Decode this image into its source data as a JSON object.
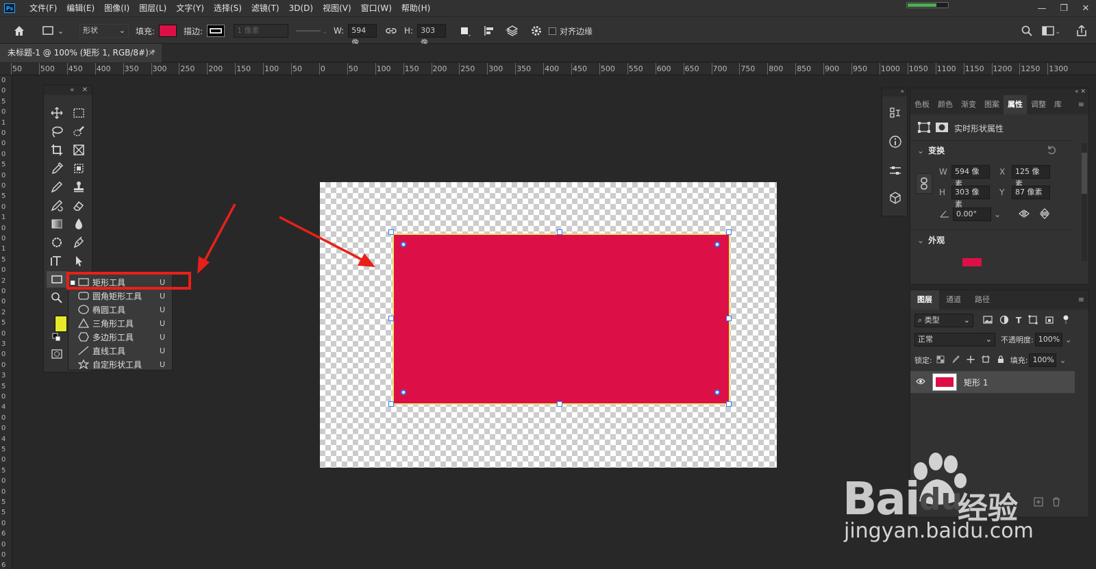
{
  "app": {
    "logo": "Ps"
  },
  "menubar": {
    "items": [
      "文件(F)",
      "编辑(E)",
      "图像(I)",
      "图层(L)",
      "文字(Y)",
      "选择(S)",
      "滤镜(T)",
      "3D(D)",
      "视图(V)",
      "窗口(W)",
      "帮助(H)"
    ],
    "window_buttons": [
      "—",
      "❐",
      "✕"
    ]
  },
  "options": {
    "mode": "形状",
    "fill_label": "填充:",
    "stroke_label": "描边:",
    "stroke_width": "1 像素",
    "w_label": "W:",
    "w_value": "594 像",
    "h_label": "H:",
    "h_value": "303 像",
    "align_edges": "对齐边缘",
    "fill_color": "#dc1046"
  },
  "document": {
    "tab_title": "未标题-1 @ 100% (矩形 1, RGB/8#) *",
    "close": "×"
  },
  "ruler": {
    "h_ticks": [
      "50",
      "500",
      "450",
      "400",
      "350",
      "300",
      "250",
      "200",
      "150",
      "100",
      "50",
      "0",
      "50",
      "100",
      "150",
      "200",
      "250",
      "300",
      "350",
      "400",
      "450",
      "500",
      "550",
      "600",
      "650",
      "700",
      "750",
      "800",
      "850",
      "900",
      "950",
      "1000",
      "1050",
      "1100",
      "1150",
      "1200",
      "1250",
      "1300"
    ],
    "v_ticks": [
      "0",
      "0",
      "5",
      "0",
      "1",
      "0",
      "0",
      "0",
      "5",
      "0",
      "0",
      "5",
      "0",
      "1",
      "0",
      "0",
      "1",
      "5",
      "0",
      "2",
      "0",
      "0",
      "2",
      "5",
      "0",
      "3",
      "0",
      "0",
      "3",
      "5",
      "0",
      "4",
      "0",
      "0",
      "4",
      "5",
      "0",
      "5",
      "0",
      "0",
      "5",
      "5",
      "0",
      "6",
      "0",
      "0",
      "6"
    ]
  },
  "toolbar": {
    "collapse": "«",
    "close": "✕",
    "foreground_color": "#e8e82a"
  },
  "flyout": {
    "items": [
      {
        "label": "矩形工具",
        "key": "U",
        "active": true
      },
      {
        "label": "圆角矩形工具",
        "key": "U"
      },
      {
        "label": "椭圆工具",
        "key": "U"
      },
      {
        "label": "三角形工具",
        "key": "U"
      },
      {
        "label": "多边形工具",
        "key": "U"
      },
      {
        "label": "直线工具",
        "key": "U"
      },
      {
        "label": "自定形状工具",
        "key": "U"
      }
    ]
  },
  "properties_panel": {
    "tabs": [
      "色板",
      "颜色",
      "渐变",
      "图案",
      "属性",
      "调整",
      "库"
    ],
    "active_tab": "属性",
    "shape_props": "实时形状属性",
    "transform_title": "变换",
    "w_label": "W",
    "w_value": "594 像素",
    "h_label": "H",
    "h_value": "303 像素",
    "x_label": "X",
    "x_value": "125 像素",
    "y_label": "Y",
    "y_value": "87 像素",
    "angle": "0.00°",
    "appearance_title": "外观",
    "appearance_color": "#dc1046"
  },
  "layers_panel": {
    "tabs": [
      "图层",
      "通道",
      "路径"
    ],
    "filter_kind": "类型",
    "blend_mode": "正常",
    "opacity_label": "不透明度:",
    "opacity_value": "100%",
    "lock_label": "锁定:",
    "fill_label": "填充:",
    "fill_value": "100%",
    "layers": [
      {
        "name": "矩形 1"
      }
    ]
  },
  "watermark": {
    "brand": "Bai",
    "brand2": "du",
    "jingyan": "经验",
    "url": "jingyan.baidu.com"
  }
}
